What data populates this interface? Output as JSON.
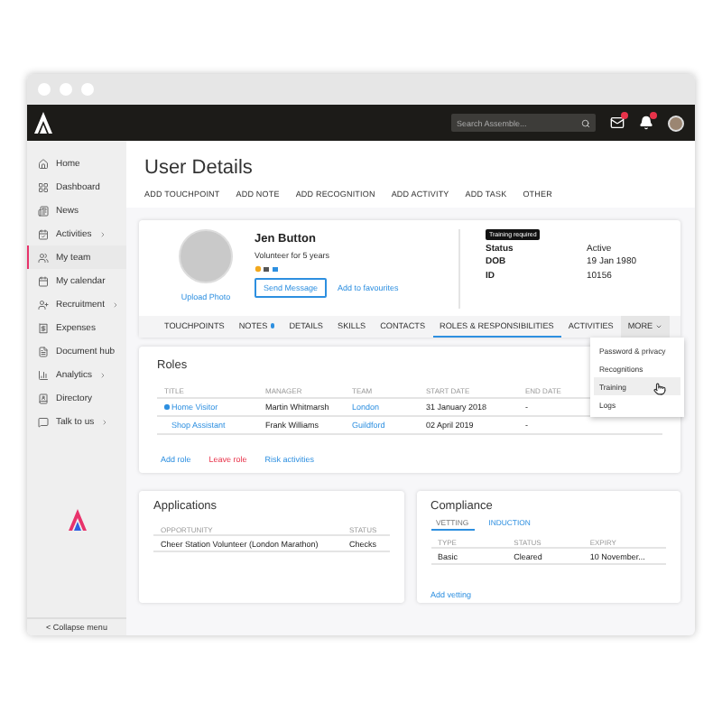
{
  "header": {
    "search": {
      "placeholder": "Search Assemble..."
    },
    "mail_unread": true,
    "alerts_unread": true
  },
  "sidebar": {
    "items": [
      {
        "label": "Home",
        "has_submenu": false,
        "selected": false
      },
      {
        "label": "Dashboard",
        "has_submenu": false,
        "selected": false
      },
      {
        "label": "News",
        "has_submenu": false,
        "selected": false
      },
      {
        "label": "Activities",
        "has_submenu": true,
        "selected": false
      },
      {
        "label": "My team",
        "has_submenu": false,
        "selected": true
      },
      {
        "label": "My calendar",
        "has_submenu": false,
        "selected": false
      },
      {
        "label": "Recruitment",
        "has_submenu": true,
        "selected": false
      },
      {
        "label": "Expenses",
        "has_submenu": false,
        "selected": false
      },
      {
        "label": "Document hub",
        "has_submenu": false,
        "selected": false
      },
      {
        "label": "Analytics",
        "has_submenu": true,
        "selected": false
      },
      {
        "label": "Directory",
        "has_submenu": false,
        "selected": false
      },
      {
        "label": "Talk to us",
        "has_submenu": true,
        "selected": false
      }
    ],
    "collapse": "< Collapse menu"
  },
  "page": {
    "title": "User Details",
    "actions": [
      "ADD TOUCHPOINT",
      "ADD NOTE",
      "ADD RECOGNITION",
      "ADD ACTIVITY",
      "ADD TASK",
      "OTHER"
    ]
  },
  "profile": {
    "name": "Jen Button",
    "subtitle": "Volunteer for 5 years",
    "upload_photo": "Upload Photo",
    "send_message": "Send Message",
    "add_favourites": "Add to favourites",
    "badge": "Training required",
    "fields": [
      {
        "label": "Status",
        "value": "Active"
      },
      {
        "label": "DOB",
        "value": "19 Jan 1980"
      },
      {
        "label": "ID",
        "value": "10156"
      }
    ]
  },
  "tabs": [
    {
      "label": "TOUCHPOINTS",
      "selected": false,
      "indicator": false
    },
    {
      "label": "NOTES",
      "selected": false,
      "indicator": true
    },
    {
      "label": "DETAILS",
      "selected": false,
      "indicator": false
    },
    {
      "label": "SKILLS",
      "selected": false,
      "indicator": false
    },
    {
      "label": "CONTACTS",
      "selected": false,
      "indicator": false
    },
    {
      "label": "ROLES & RESPONSIBILITIES",
      "selected": true,
      "indicator": false
    },
    {
      "label": "ACTIVITIES",
      "selected": false,
      "indicator": false
    }
  ],
  "more_menu": {
    "label": "MORE",
    "expanded": true,
    "items": [
      {
        "label": "Password & privacy",
        "selected": false
      },
      {
        "label": "Recognitions",
        "selected": false
      },
      {
        "label": "Training",
        "selected": true
      },
      {
        "label": "Logs",
        "selected": false
      }
    ]
  },
  "roles": {
    "title": "Roles",
    "columns": [
      "TITLE",
      "MANAGER",
      "TEAM",
      "START DATE",
      "END DATE"
    ],
    "rows": [
      {
        "title": "Home Visitor",
        "primary": true,
        "manager": "Martin Whitmarsh",
        "team": "London",
        "start": "31 January 2018",
        "end": "-"
      },
      {
        "title": "Shop Assistant",
        "primary": false,
        "manager": "Frank Williams",
        "team": "Guildford",
        "start": "02 April 2019",
        "end": "-"
      }
    ],
    "links": [
      {
        "label": "Add role",
        "kind": "normal"
      },
      {
        "label": "Leave role",
        "kind": "danger"
      },
      {
        "label": "Risk activities",
        "kind": "normal"
      }
    ]
  },
  "applications": {
    "title": "Applications",
    "columns": [
      "OPPORTUNITY",
      "STATUS"
    ],
    "rows": [
      [
        "Cheer Station Volunteer  (London Marathon)",
        "Checks"
      ]
    ]
  },
  "compliance": {
    "title": "Compliance",
    "tabs": [
      {
        "label": "VETTING",
        "selected": true
      },
      {
        "label": "INDUCTION",
        "selected": false
      }
    ],
    "columns": [
      "TYPE",
      "STATUS",
      "EXPIRY"
    ],
    "rows": [
      [
        "Basic",
        "Cleared",
        "10 November..."
      ]
    ],
    "add_link": "Add vetting"
  }
}
